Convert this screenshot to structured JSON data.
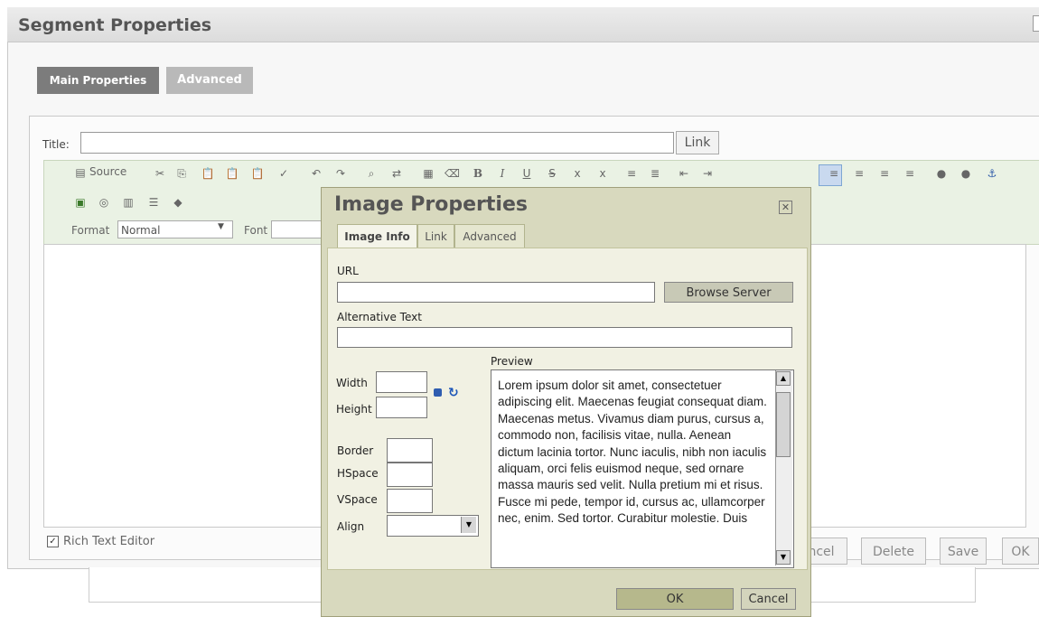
{
  "panel": {
    "title": "Segment Properties"
  },
  "tabs": {
    "main": "Main Properties",
    "advanced": "Advanced"
  },
  "title_field": {
    "label": "Title:",
    "value": "",
    "link_button": "Link"
  },
  "toolbar": {
    "source_label": "Source",
    "format_label": "Format",
    "format_value": "Normal",
    "font_label": "Font",
    "icons": [
      "cut-icon",
      "copy-icon",
      "paste-icon",
      "paste-text-icon",
      "paste-word-icon",
      "spellcheck-icon",
      "undo-icon",
      "redo-icon",
      "find-icon",
      "replace-icon",
      "select-all-icon",
      "remove-format-icon",
      "bold-icon",
      "italic-icon",
      "underline-icon",
      "strike-icon",
      "subscript-icon",
      "superscript-icon",
      "numbered-list-icon",
      "bulleted-list-icon",
      "outdent-icon",
      "indent-icon",
      "align-left-icon",
      "align-center-icon",
      "align-right-icon",
      "justify-icon",
      "link-icon",
      "unlink-icon",
      "anchor-icon",
      "image-icon",
      "flash-icon",
      "table-icon",
      "horizontal-rule-icon",
      "special-char-icon"
    ]
  },
  "rich_text_editor": {
    "label": "Rich Text Editor",
    "checked": true
  },
  "footer_buttons": {
    "cancel": "ncel",
    "delete": "Delete",
    "save": "Save",
    "ok": "OK"
  },
  "image_dialog": {
    "title": "Image Properties",
    "tabs": [
      "Image Info",
      "Link",
      "Advanced"
    ],
    "url_label": "URL",
    "url_value": "",
    "browse_button": "Browse Server",
    "alt_label": "Alternative Text",
    "alt_value": "",
    "width_label": "Width",
    "height_label": "Height",
    "border_label": "Border",
    "hspace_label": "HSpace",
    "vspace_label": "VSpace",
    "align_label": "Align",
    "align_value": "",
    "preview_label": "Preview",
    "preview_text": "Lorem ipsum dolor sit amet, consectetuer adipiscing elit. Maecenas feugiat consequat diam. Maecenas metus. Vivamus diam purus, cursus a, commodo non, facilisis vitae, nulla. Aenean dictum lacinia tortor. Nunc iaculis, nibh non iaculis aliquam, orci felis euismod neque, sed ornare massa mauris sed velit. Nulla pretium mi et risus. Fusce mi pede, tempor id, cursus ac, ullamcorper nec, enim. Sed tortor. Curabitur molestie. Duis",
    "ok_button": "OK",
    "cancel_button": "Cancel"
  }
}
